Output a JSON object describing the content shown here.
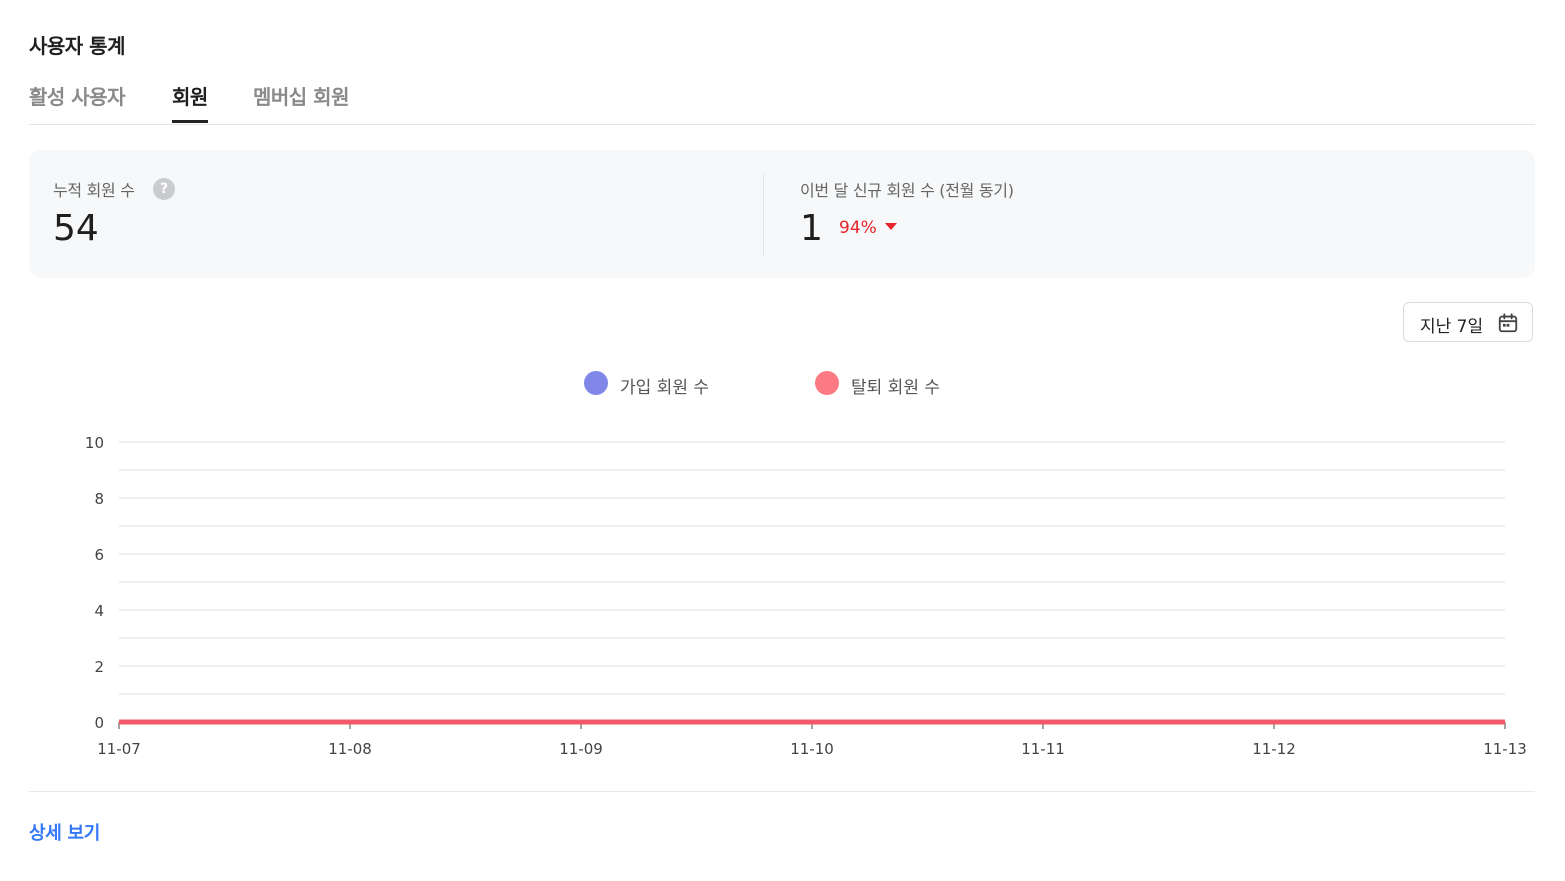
{
  "page": {
    "title": "사용자 통계"
  },
  "tabs": [
    {
      "label": "활성 사용자",
      "active": false
    },
    {
      "label": "회원",
      "active": true
    },
    {
      "label": "멤버십 회원",
      "active": false
    }
  ],
  "stats": {
    "total": {
      "label": "누적 회원 수",
      "help_icon": "?",
      "value": "54"
    },
    "new_this_month": {
      "label": "이번 달 신규 회원 수 (전월 동기)",
      "value": "1",
      "change": "94%",
      "change_direction": "down",
      "change_color": "#e5242b"
    }
  },
  "range": {
    "label": "지난 7일",
    "icon": "calendar-icon"
  },
  "legend": [
    {
      "label": "가입 회원 수",
      "color": "#8187e8"
    },
    {
      "label": "탈퇴 회원 수",
      "color": "#fd7a85"
    }
  ],
  "chart_data": {
    "type": "line",
    "x": [
      "11-07",
      "11-08",
      "11-09",
      "11-10",
      "11-11",
      "11-12",
      "11-13"
    ],
    "yticks": [
      0,
      2,
      4,
      6,
      8,
      10
    ],
    "ylim": [
      0,
      10
    ],
    "grid": true,
    "legend_position": "top-center",
    "series": [
      {
        "name": "가입 회원 수",
        "color": "#8187e8",
        "values": [
          0,
          0,
          0,
          0,
          0,
          0,
          0
        ]
      },
      {
        "name": "탈퇴 회원 수",
        "color": "#f25a6a",
        "values": [
          0,
          0,
          0,
          0,
          0,
          0,
          0
        ]
      }
    ]
  },
  "footer": {
    "detail_link": "상세 보기"
  }
}
